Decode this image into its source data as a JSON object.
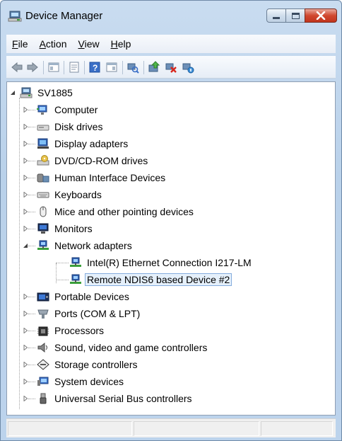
{
  "window": {
    "title": "Device Manager",
    "title_icon": "device-manager-icon"
  },
  "menu": [
    {
      "label": "File",
      "accel": "F",
      "rest": "ile"
    },
    {
      "label": "Action",
      "accel": "A",
      "rest": "ction"
    },
    {
      "label": "View",
      "accel": "V",
      "rest": "iew"
    },
    {
      "label": "Help",
      "accel": "H",
      "rest": "elp"
    }
  ],
  "toolbar": {
    "buttons": [
      "back-icon",
      "forward-icon",
      "show-hide-tree-icon",
      "properties-icon",
      "help-icon",
      "view-icon",
      "scan-hardware-icon",
      "update-driver-icon",
      "uninstall-icon",
      "disable-icon"
    ]
  },
  "tree": {
    "root": {
      "label": "SV1885",
      "icon": "computer-root-icon",
      "expanded": true
    },
    "categories": [
      {
        "label": "Computer",
        "icon": "computer-icon",
        "expanded": false
      },
      {
        "label": "Disk drives",
        "icon": "disk-drive-icon",
        "expanded": false
      },
      {
        "label": "Display adapters",
        "icon": "display-adapter-icon",
        "expanded": false
      },
      {
        "label": "DVD/CD-ROM drives",
        "icon": "dvd-drive-icon",
        "expanded": false
      },
      {
        "label": "Human Interface Devices",
        "icon": "hid-icon",
        "expanded": false
      },
      {
        "label": "Keyboards",
        "icon": "keyboard-icon",
        "expanded": false
      },
      {
        "label": "Mice and other pointing devices",
        "icon": "mouse-icon",
        "expanded": false
      },
      {
        "label": "Monitors",
        "icon": "monitor-icon",
        "expanded": false
      },
      {
        "label": "Network adapters",
        "icon": "network-adapter-icon",
        "expanded": true,
        "children": [
          {
            "label": "Intel(R) Ethernet Connection I217-LM",
            "icon": "network-adapter-icon",
            "selected": false
          },
          {
            "label": "Remote NDIS6 based Device #2",
            "icon": "network-adapter-icon",
            "selected": true
          }
        ]
      },
      {
        "label": "Portable Devices",
        "icon": "portable-device-icon",
        "expanded": false
      },
      {
        "label": "Ports (COM & LPT)",
        "icon": "port-icon",
        "expanded": false
      },
      {
        "label": "Processors",
        "icon": "processor-icon",
        "expanded": false
      },
      {
        "label": "Sound, video and game controllers",
        "icon": "sound-icon",
        "expanded": false
      },
      {
        "label": "Storage controllers",
        "icon": "storage-controller-icon",
        "expanded": false
      },
      {
        "label": "System devices",
        "icon": "system-device-icon",
        "expanded": false
      },
      {
        "label": "Universal Serial Bus controllers",
        "icon": "usb-icon",
        "expanded": false
      }
    ]
  },
  "statusbar": {
    "text": ""
  },
  "colors": {
    "selection_bg": "#e5f0fb",
    "selection_border": "#84acdd",
    "title_bar": "#bcd3ec",
    "close_button": "#c2341c"
  }
}
